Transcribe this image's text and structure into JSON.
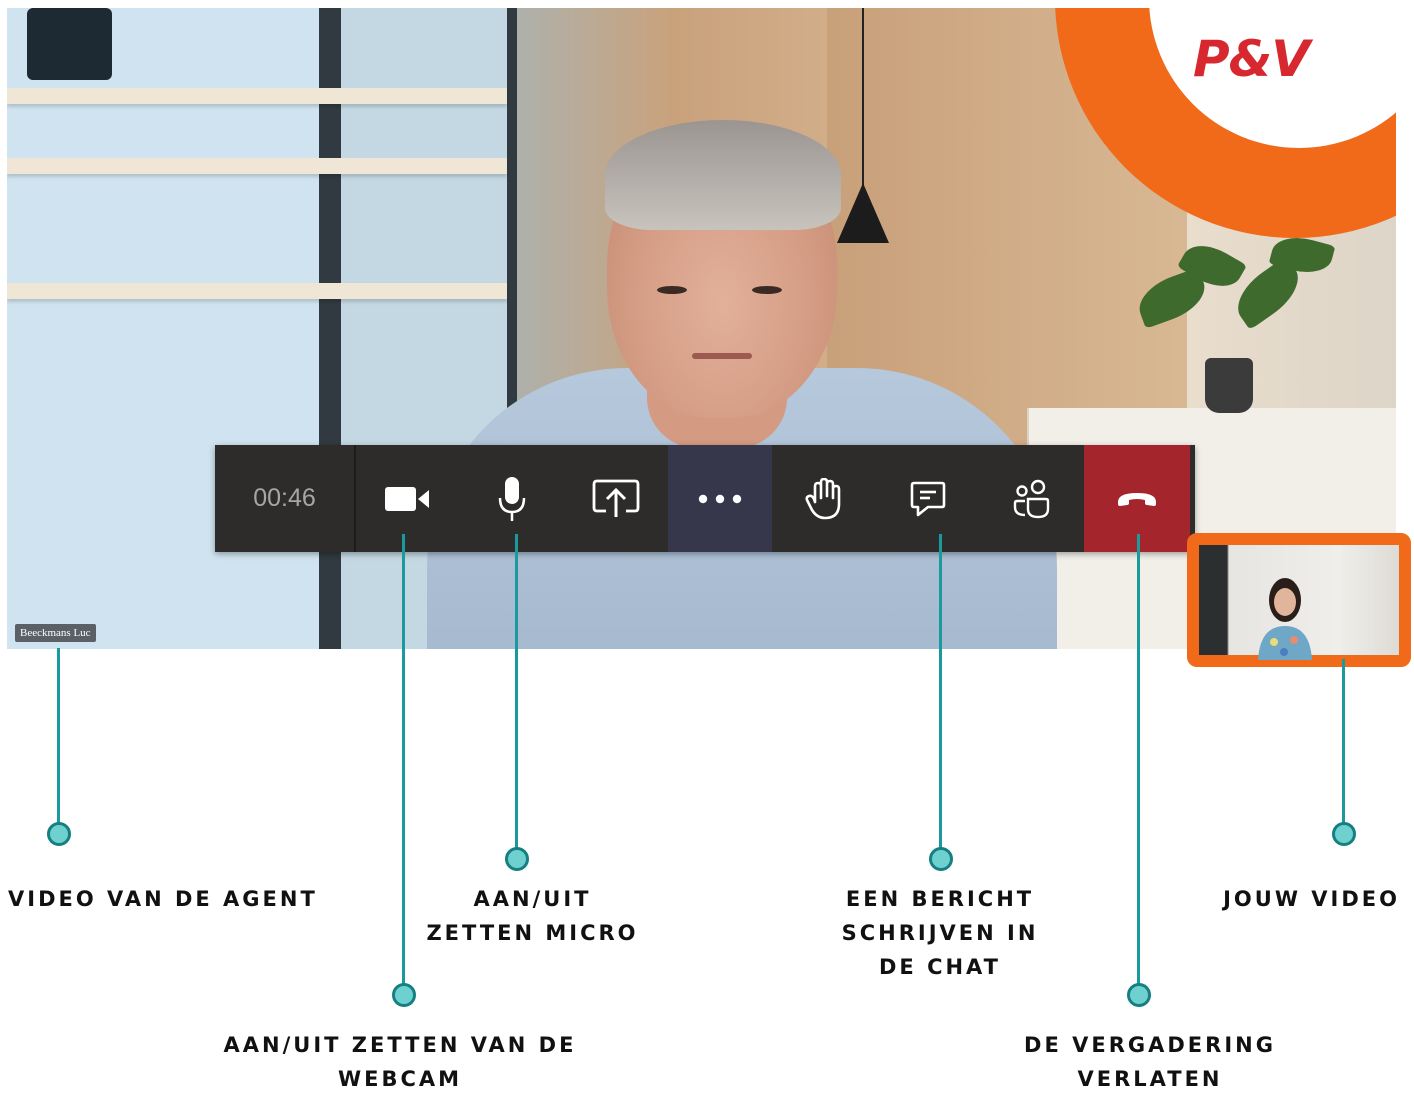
{
  "video": {
    "participant_name": "Beeckmans Luc",
    "brand_logo_text": "P&V"
  },
  "controls": {
    "timer": "00:46",
    "buttons": [
      {
        "name": "camera",
        "icon": "video-camera-icon"
      },
      {
        "name": "microphone",
        "icon": "microphone-icon"
      },
      {
        "name": "share-screen",
        "icon": "share-screen-icon"
      },
      {
        "name": "more-actions",
        "icon": "more-horizontal-icon"
      },
      {
        "name": "raise-hand",
        "icon": "raise-hand-icon"
      },
      {
        "name": "chat",
        "icon": "chat-icon"
      },
      {
        "name": "participants",
        "icon": "participants-icon"
      },
      {
        "name": "hang-up",
        "icon": "hang-up-icon"
      }
    ]
  },
  "callouts": {
    "agent_video": "VIDEO VAN DE AGENT",
    "webcam_line1": "AAN/UIT ZETTEN VAN DE",
    "webcam_line2": "WEBCAM",
    "micro_line1": "AAN/UIT",
    "micro_line2": "ZETTEN MICRO",
    "chat_line1": "EEN BERICHT",
    "chat_line2": "SCHRIJVEN IN",
    "chat_line3": "DE CHAT",
    "leave_line1": "DE VERGADERING",
    "leave_line2": "VERLATEN",
    "your_video": "JOUW VIDEO"
  },
  "colors": {
    "accent_teal": "#1a9a9c",
    "brand_orange": "#f06a1a",
    "hangup_red": "#a4262c",
    "toolbar": "#2d2c2b"
  }
}
